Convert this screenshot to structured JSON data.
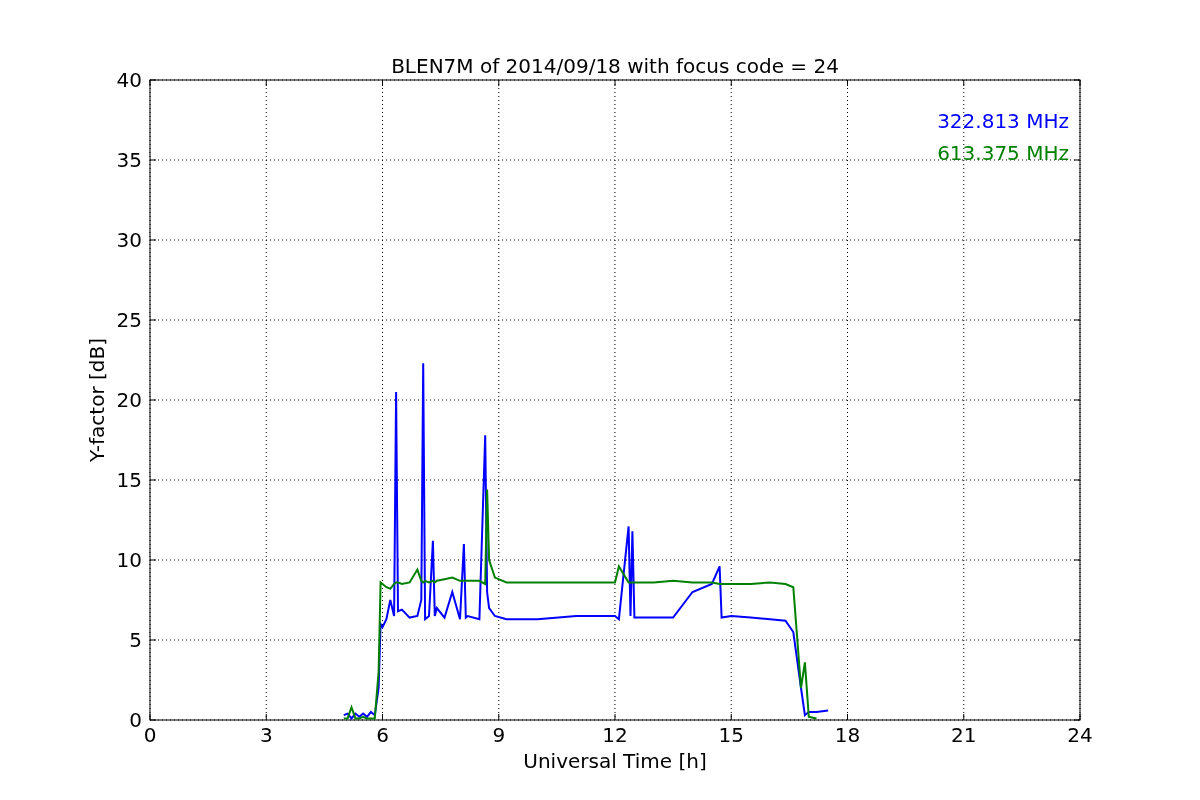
{
  "figure": {
    "chart_data": {
      "type": "line",
      "title": "BLEN7M of 2014/09/18 with focus code = 24",
      "xlabel": "Universal Time [h]",
      "ylabel": "Y-factor [dB]",
      "x": [
        5.0,
        5.1,
        5.2,
        5.3,
        5.4,
        5.5,
        5.6,
        5.7,
        5.8,
        5.9,
        5.95,
        6.0,
        6.1,
        6.2,
        6.3,
        6.35,
        6.4,
        6.5,
        6.7,
        6.9,
        7.0,
        7.05,
        7.1,
        7.2,
        7.3,
        7.35,
        7.4,
        7.6,
        7.8,
        8.0,
        8.1,
        8.15,
        8.2,
        8.5,
        8.65,
        8.7,
        8.75,
        8.9,
        9.2,
        10,
        11,
        12,
        12.1,
        12.35,
        12.4,
        12.45,
        12.5,
        13,
        13.5,
        14,
        14.5,
        14.7,
        14.75,
        15,
        15.5,
        16,
        16.4,
        16.6,
        16.8,
        16.9,
        17.0,
        17.2,
        17.5
      ],
      "series": [
        {
          "name": "322.813 MHz",
          "color": "#0000ff",
          "values": [
            0.3,
            0.4,
            0.1,
            0.4,
            0.2,
            0.4,
            0.2,
            0.5,
            0.3,
            2,
            6,
            5.8,
            6.3,
            7.5,
            6.5,
            20.5,
            6.8,
            6.9,
            6.4,
            6.5,
            7.5,
            22.3,
            6.3,
            6.5,
            11.2,
            6.5,
            7.0,
            6.4,
            8.0,
            6.3,
            11.0,
            6.4,
            6.5,
            6.3,
            17.8,
            8,
            7,
            6.5,
            6.3,
            6.3,
            6.5,
            6.5,
            6.3,
            12.1,
            6.5,
            11.8,
            6.4,
            6.4,
            6.4,
            8,
            8.5,
            9.6,
            6.4,
            6.5,
            6.4,
            6.3,
            6.2,
            5.5,
            2,
            0.3,
            0.5,
            0.5,
            0.6
          ]
        },
        {
          "name": "613.375 MHz",
          "color": "#008000",
          "values": [
            0.1,
            0.1,
            0.8,
            0.1,
            0.1,
            0.2,
            0.1,
            0.1,
            0.1,
            3,
            8.6,
            8.5,
            8.3,
            8.2,
            8.5,
            8.6,
            8.6,
            8.5,
            8.6,
            9.4,
            8.7,
            8.6,
            8.7,
            8.6,
            8.7,
            8.6,
            8.7,
            8.8,
            8.9,
            8.7,
            8.7,
            8.7,
            8.7,
            8.7,
            8.5,
            14.4,
            10,
            8.9,
            8.6,
            8.6,
            8.6,
            8.6,
            9.6,
            8.6,
            8.6,
            8.6,
            8.6,
            8.6,
            8.7,
            8.6,
            8.6,
            8.5,
            8.5,
            8.5,
            8.5,
            8.6,
            8.5,
            8.3,
            2,
            3.6,
            0.2,
            0.1,
            null
          ]
        }
      ],
      "grid": true,
      "xlim": [
        0,
        24
      ],
      "ylim": [
        0,
        40
      ],
      "xticks": [
        0,
        3,
        6,
        9,
        12,
        15,
        18,
        21,
        24
      ],
      "yticks": [
        0,
        5,
        10,
        15,
        20,
        25,
        30,
        35,
        40
      ]
    }
  }
}
